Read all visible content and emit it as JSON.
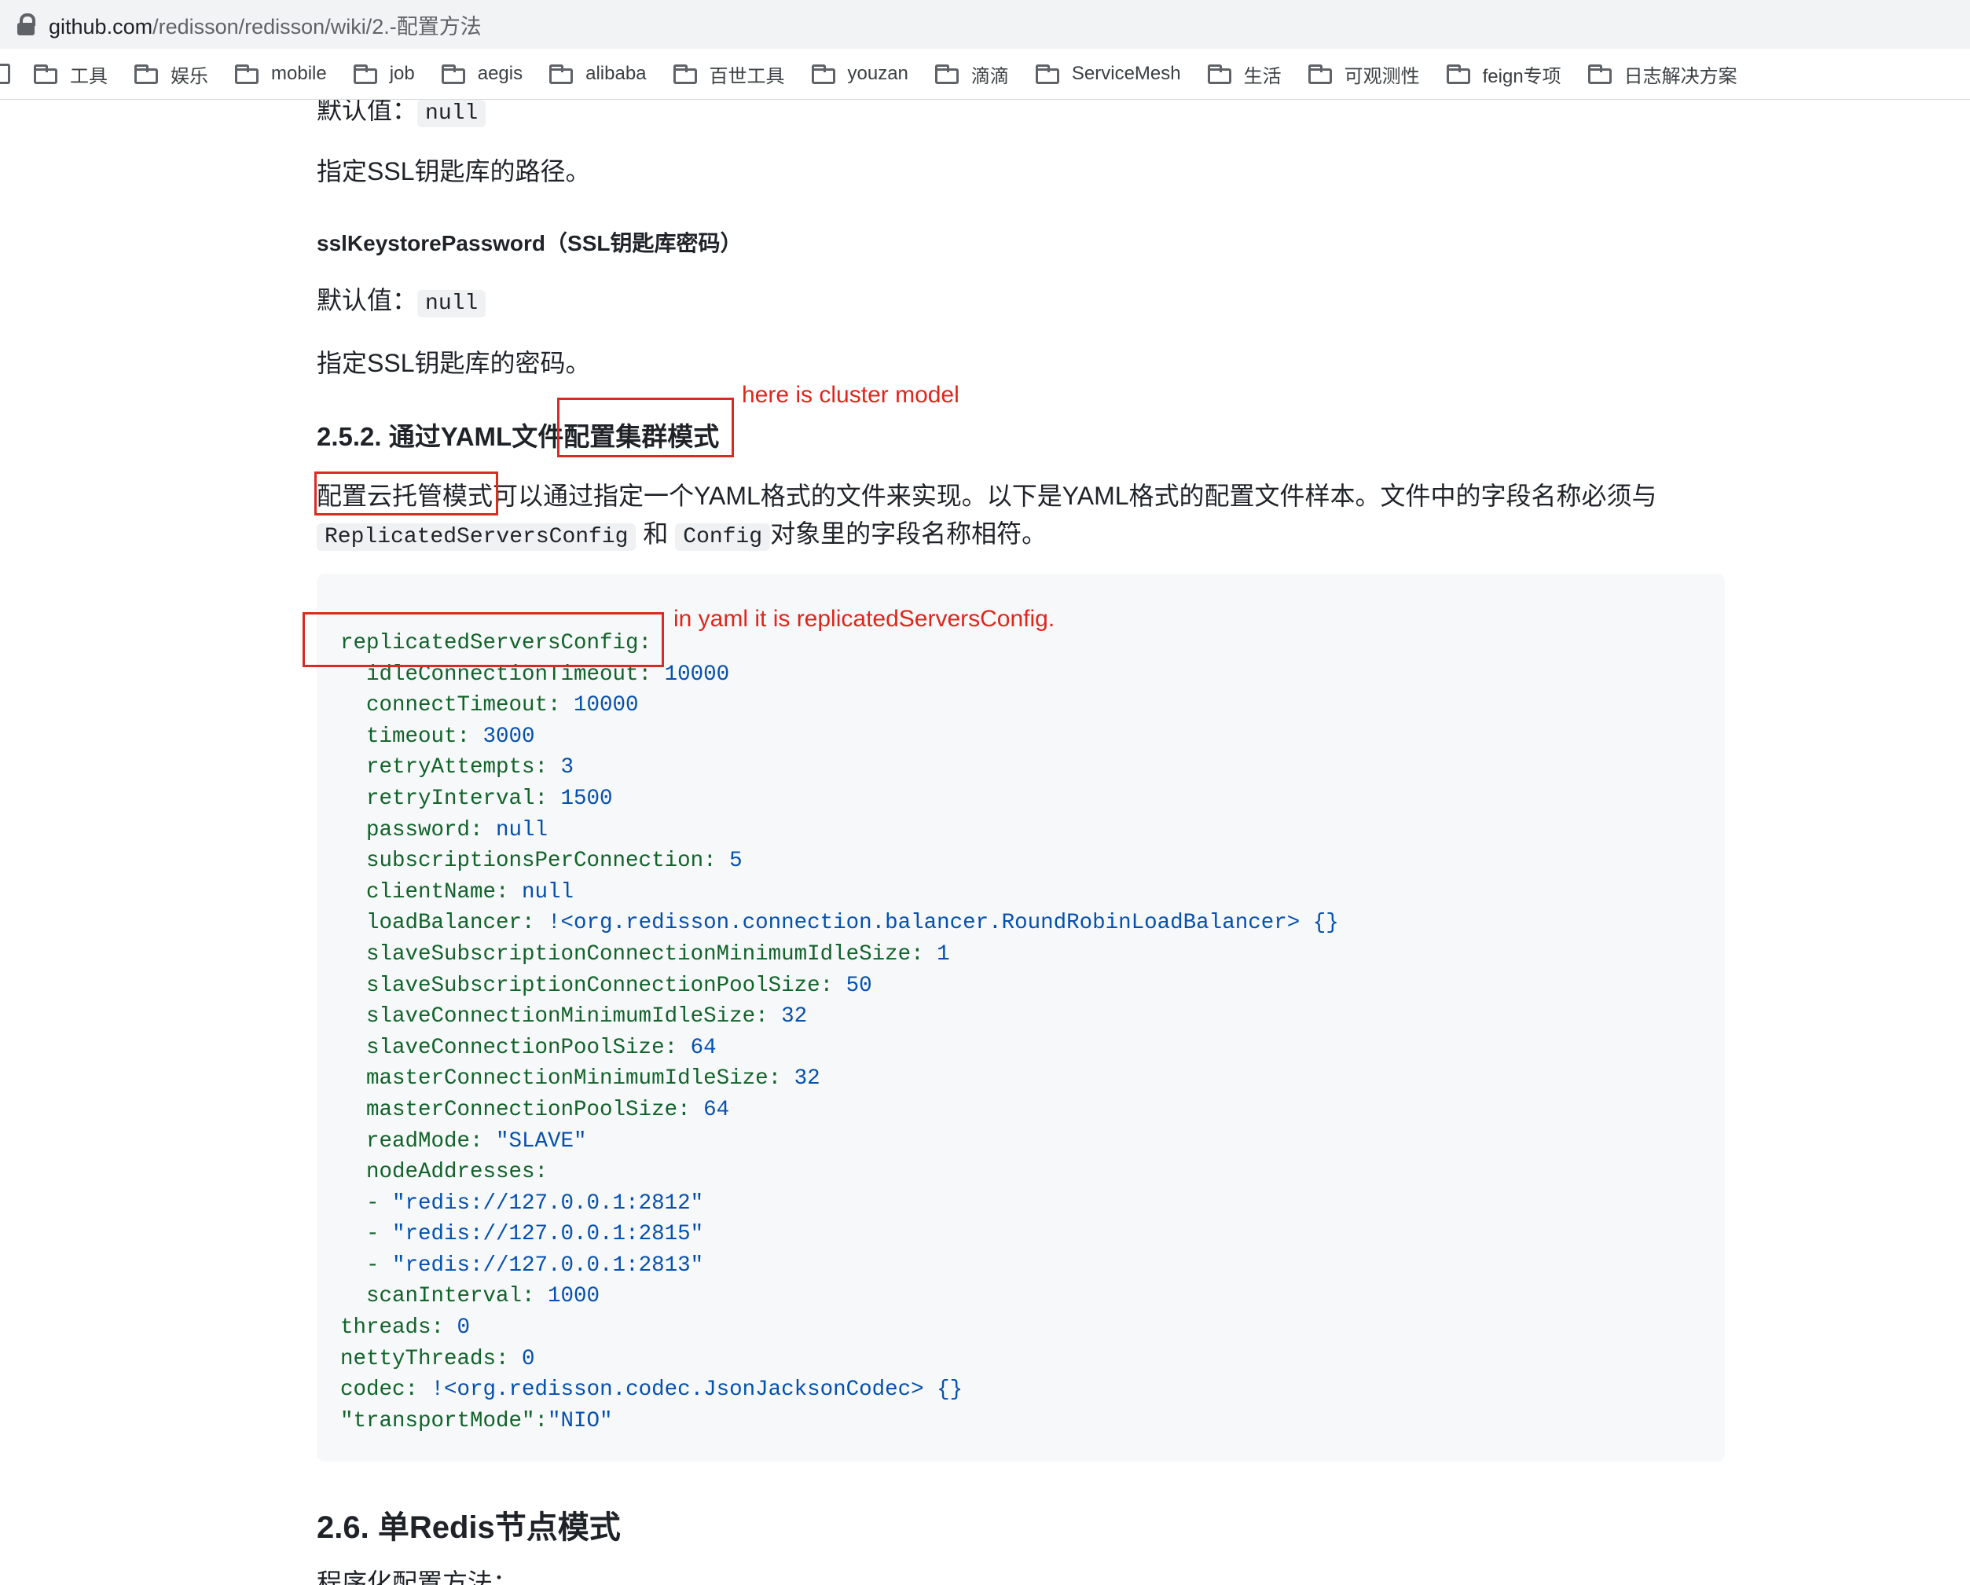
{
  "browser": {
    "url_host": "github.com",
    "url_path": "/redisson/redisson/wiki/2.-配置方法",
    "bookmarks": [
      "工具",
      "娱乐",
      "mobile",
      "job",
      "aegis",
      "alibaba",
      "百世工具",
      "youzan",
      "滴滴",
      "ServiceMesh",
      "生活",
      "可观测性",
      "feign专项",
      "日志解决方案"
    ]
  },
  "page": {
    "top_default_label": "默认值：",
    "top_default_value": "null",
    "keystore_path_desc": "指定SSL钥匙库的路径。",
    "keystore_password_heading": "sslKeystorePassword（SSL钥匙库密码）",
    "default_label": "默认值：",
    "default_value": "null",
    "keystore_password_desc": "指定SSL钥匙库的密码。",
    "section_heading_prefix": "2.5.2. 通过YAML文件",
    "section_heading_boxed": "配置集群模式",
    "para_boxed": "配置云托管模式",
    "para_rest": "可以通过指定一个YAML格式的文件来实现。以下是YAML格式的配置文件样本。文件中的字段名称必须与",
    "para_code1": "ReplicatedServersConfig",
    "para_and": "和",
    "para_code2": "Config",
    "para_end": "对象里的字段名称相符。",
    "next_section_heading": "2.6. 单Redis节点模式",
    "next_section_sub": "程序化配置方法："
  },
  "code": {
    "lines": [
      {
        "key": "replicatedServersConfig:",
        "val": ""
      },
      {
        "key": "  idleConnectionTimeout:",
        "val": " 10000"
      },
      {
        "key": "  connectTimeout:",
        "val": " 10000"
      },
      {
        "key": "  timeout:",
        "val": " 3000"
      },
      {
        "key": "  retryAttempts:",
        "val": " 3"
      },
      {
        "key": "  retryInterval:",
        "val": " 1500"
      },
      {
        "key": "  password:",
        "val": " null"
      },
      {
        "key": "  subscriptionsPerConnection:",
        "val": " 5"
      },
      {
        "key": "  clientName:",
        "val": " null"
      },
      {
        "key": "  loadBalancer:",
        "val": " !<org.redisson.connection.balancer.RoundRobinLoadBalancer> {}"
      },
      {
        "key": "  slaveSubscriptionConnectionMinimumIdleSize:",
        "val": " 1"
      },
      {
        "key": "  slaveSubscriptionConnectionPoolSize:",
        "val": " 50"
      },
      {
        "key": "  slaveConnectionMinimumIdleSize:",
        "val": " 32"
      },
      {
        "key": "  slaveConnectionPoolSize:",
        "val": " 64"
      },
      {
        "key": "  masterConnectionMinimumIdleSize:",
        "val": " 32"
      },
      {
        "key": "  masterConnectionPoolSize:",
        "val": " 64"
      },
      {
        "key": "  readMode:",
        "val": " \"SLAVE\""
      },
      {
        "key": "  nodeAddresses:",
        "val": ""
      },
      {
        "key": "  - ",
        "val": "\"redis://127.0.0.1:2812\""
      },
      {
        "key": "  - ",
        "val": "\"redis://127.0.0.1:2815\""
      },
      {
        "key": "  - ",
        "val": "\"redis://127.0.0.1:2813\""
      },
      {
        "key": "  scanInterval:",
        "val": " 1000"
      },
      {
        "key": "threads:",
        "val": " 0"
      },
      {
        "key": "nettyThreads:",
        "val": " 0"
      },
      {
        "key": "codec:",
        "val": " !<org.redisson.codec.JsonJacksonCodec> {}"
      },
      {
        "key": "\"transportMode\":",
        "val": "\"NIO\""
      }
    ]
  },
  "annotations": {
    "cluster_note": "here is cluster model",
    "yaml_note": "in yaml it is replicatedServersConfig."
  },
  "colors": {
    "annotation_red": "#d92c20",
    "code_key": "#116329",
    "code_value": "#0550ae"
  }
}
